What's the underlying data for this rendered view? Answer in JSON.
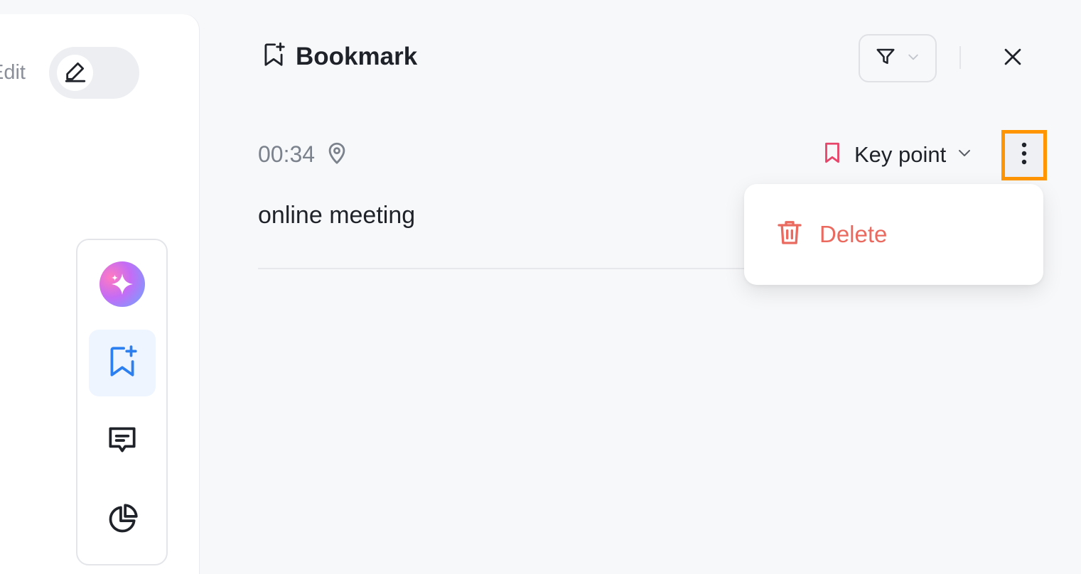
{
  "sidebar": {
    "edit_label": "Edit",
    "tools": [
      {
        "name": "ai-assistant",
        "icon": "sparkle-icon"
      },
      {
        "name": "bookmark",
        "icon": "bookmark-add-icon",
        "active": true
      },
      {
        "name": "comments",
        "icon": "message-icon"
      },
      {
        "name": "statistics",
        "icon": "pie-chart-icon"
      }
    ]
  },
  "header": {
    "title": "Bookmark",
    "title_icon": "bookmark-add-icon",
    "filter_icon": "filter-icon",
    "close_icon": "close-icon"
  },
  "bookmark_entry": {
    "time": "00:34",
    "location_icon": "location-pin-icon",
    "tag_label": "Key point",
    "tag_icon": "bookmark-icon",
    "note": "online meeting"
  },
  "context_menu": {
    "items": [
      {
        "label": "Delete",
        "icon": "trash-icon"
      }
    ]
  },
  "colors": {
    "accent_blue": "#2b7ff0",
    "tag_pink": "#e8456b",
    "delete_red": "#ea6a5f",
    "highlight_orange": "#ff9500"
  }
}
